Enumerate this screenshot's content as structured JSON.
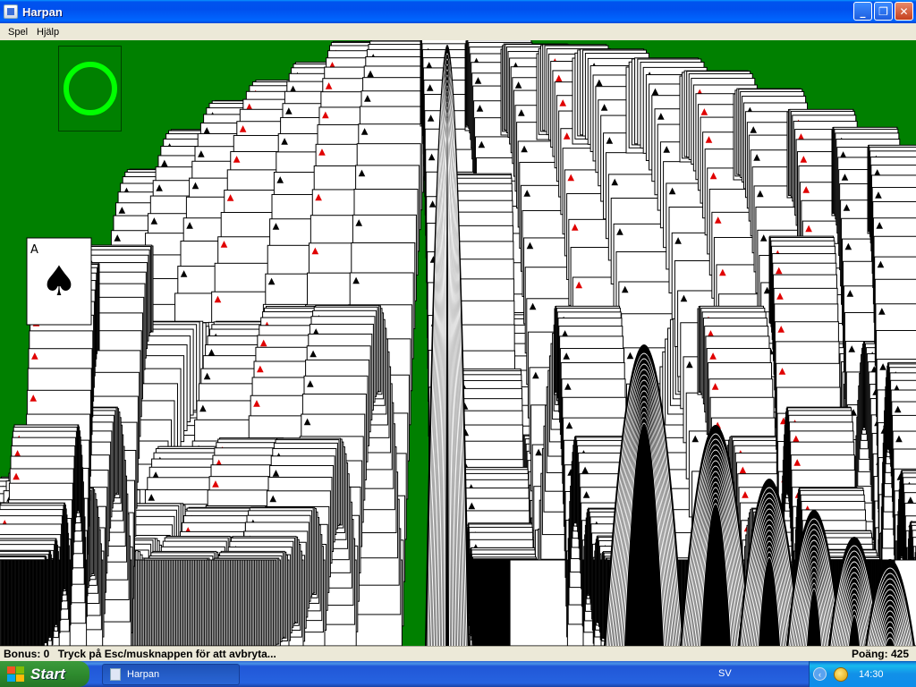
{
  "window": {
    "title": "Harpan",
    "minimize_glyph": "_",
    "maximize_glyph": "❐",
    "close_glyph": "✕"
  },
  "menu": [
    "Spel",
    "Hjälp"
  ],
  "game": {
    "felt_color": "#008000",
    "stock_ring_color": "#00ff00",
    "ace_rank": "A",
    "ace_suit": "♠"
  },
  "status": {
    "bonus": "Bonus: 0",
    "message": "Tryck på Esc/musknappen för att avbryta...",
    "score": "Poäng: 425"
  },
  "taskbar": {
    "start_label": "Start",
    "task_label": "Harpan",
    "language": "SV",
    "clock": "14:30"
  }
}
